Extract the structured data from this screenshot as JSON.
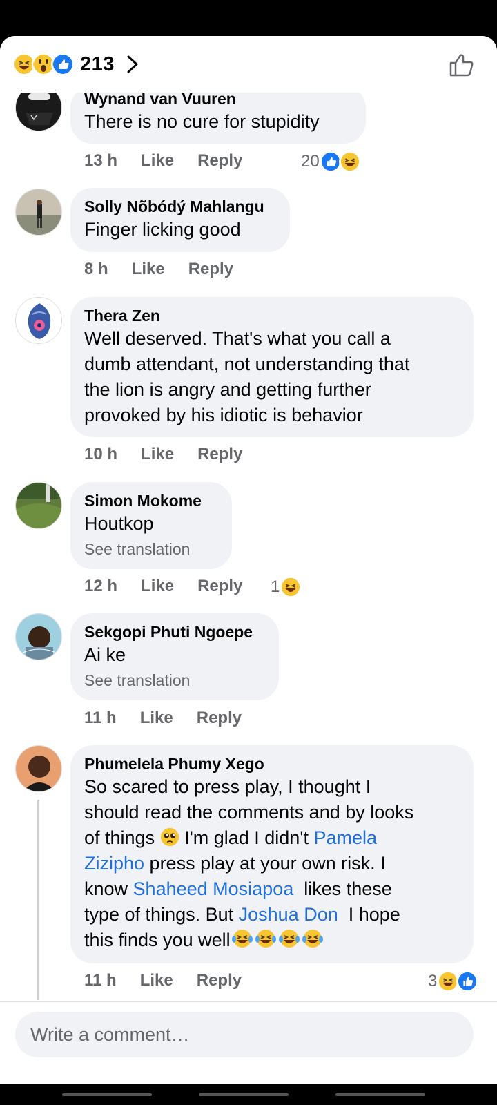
{
  "header": {
    "reaction_count": "213",
    "reaction_icons": [
      "haha",
      "wow",
      "like"
    ],
    "chevron_icon": "chevron-right-icon",
    "like_icon": "thumbs-up-outline-icon"
  },
  "colors": {
    "link": "#216fdb",
    "bubble": "#f0f2f5",
    "meta": "#65676b",
    "like_blue": "#1877f2",
    "emoji_yellow": "#f7c531"
  },
  "comments": [
    {
      "name": "Wynand van Vuuren",
      "text": "There is no cure for stupidity",
      "time": "13 h",
      "like": "Like",
      "reply": "Reply",
      "reaction_count": "20",
      "reactions": [
        "like",
        "haha"
      ]
    },
    {
      "name": "Solly Nõbódý Mahlangu",
      "text": "Finger licking good",
      "time": "8 h",
      "like": "Like",
      "reply": "Reply"
    },
    {
      "name": "Thera Zen",
      "lines": [
        "Well deserved. That's what you call a",
        "dumb attendant, not understanding that",
        "the lion is angry and getting further",
        "provoked by his idiotic is behavior"
      ],
      "time": "10 h",
      "like": "Like",
      "reply": "Reply"
    },
    {
      "name": "Simon Mokome",
      "text": "Houtkop",
      "see_translation": "See translation",
      "time": "12 h",
      "like": "Like",
      "reply": "Reply",
      "reaction_count": "1",
      "reactions": [
        "haha"
      ]
    },
    {
      "name": "Sekgopi Phuti Ngoepe",
      "text": "Ai ke",
      "see_translation": "See translation",
      "time": "11 h",
      "like": "Like",
      "reply": "Reply"
    },
    {
      "name": "Phumelela Phumy Xego",
      "parts": {
        "l1": "So scared to press play, I thought I",
        "l2": "should read the comments and by looks",
        "l3a": "of things ",
        "l3b": " I'm glad I didn't ",
        "m1a": "Pamela",
        "m1b": "Zizipho",
        "l4": " press play at your own risk. I",
        "l5a": "know ",
        "m2": "Shaheed Mosiapoa",
        "l5b": "  likes these",
        "l6a": "type of things. But ",
        "m3": "Joshua Don",
        "l6b": "  I hope",
        "l7": "this finds you well"
      },
      "time": "11 h",
      "like": "Like",
      "reply": "Reply",
      "reaction_count": "3",
      "reactions": [
        "haha",
        "like"
      ]
    }
  ],
  "composer": {
    "placeholder": "Write a comment…"
  }
}
